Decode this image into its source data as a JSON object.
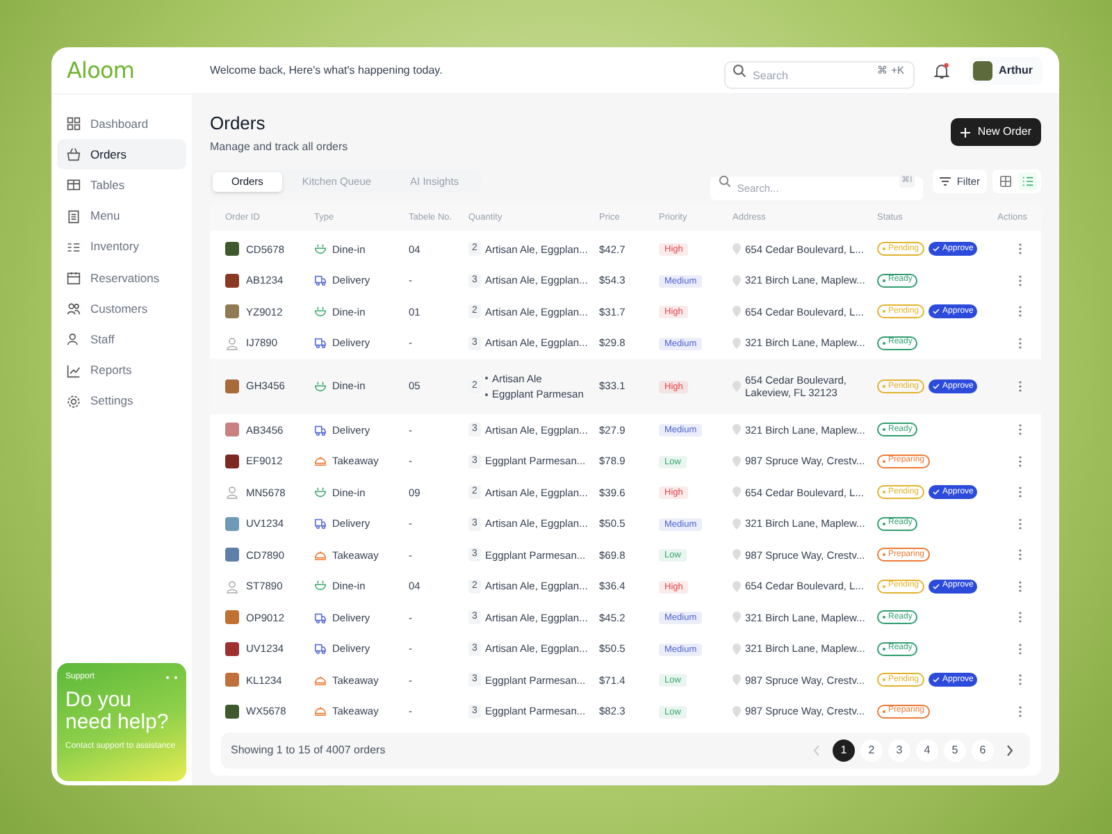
{
  "logo": "Aloom",
  "sidebar": {
    "items": [
      {
        "label": "Dashboard",
        "selected": false
      },
      {
        "label": "Orders",
        "selected": true
      },
      {
        "label": "Tables",
        "selected": false
      },
      {
        "label": "Menu",
        "selected": false
      },
      {
        "label": "Inventory",
        "selected": false
      },
      {
        "label": "Reservations",
        "selected": false
      },
      {
        "label": "Customers",
        "selected": false
      },
      {
        "label": "Staff",
        "selected": false
      },
      {
        "label": "Reports",
        "selected": false
      },
      {
        "label": "Settings",
        "selected": false
      }
    ],
    "support": {
      "label": "Support",
      "title": "Do you need help?",
      "text": "Contact support to assistance"
    }
  },
  "topbar": {
    "welcome": "Welcome back, Here's what's happening today.",
    "search": {
      "placeholder": "Search",
      "shortcut": "⌘ +K"
    },
    "notifications": {
      "unread": true
    },
    "user": {
      "name": "Arthur"
    }
  },
  "page": {
    "title": "Orders",
    "subtitle": "Manage and track all orders",
    "new_button": "New Order"
  },
  "tabs": [
    {
      "label": "Orders",
      "selected": true
    },
    {
      "label": "Kitchen Queue",
      "selected": false
    },
    {
      "label": "AI Insights",
      "selected": false
    }
  ],
  "table_search": {
    "placeholder": "Search...",
    "shortcut": "⌘I"
  },
  "filter_button": "Filter",
  "view_toggle": [
    {
      "kind": "grid",
      "selected": false
    },
    {
      "kind": "list",
      "selected": true
    }
  ],
  "table": {
    "columns": [
      "Order ID",
      "Type",
      "Tabele No.",
      "Quantity",
      "Price",
      "Priority",
      "Address",
      "Status",
      "Actions"
    ],
    "rows": [
      {
        "id": "CD5678",
        "avatar": {
          "kind": "photo"
        },
        "type": {
          "kind": "dine-in",
          "label": "Dine-in"
        },
        "table": "04",
        "qty": "2",
        "items": "Artisan Ale, Eggplan...",
        "price": "$42.7",
        "priority": {
          "label": "High",
          "color": "#e5484d"
        },
        "address": "654 Cedar Boulevard, L...",
        "status": {
          "label": "Pending",
          "color": "#e3b22c"
        },
        "approve": "Approve",
        "expanded": false
      },
      {
        "id": "AB1234",
        "avatar": {
          "kind": "photo"
        },
        "type": {
          "kind": "delivery",
          "label": "Delivery"
        },
        "table": "-",
        "qty": "3",
        "items": "Artisan Ale, Eggplan...",
        "price": "$54.3",
        "priority": {
          "label": "Medium",
          "color": "#4c63d2"
        },
        "address": "321 Birch Lane, Maplew...",
        "status": {
          "label": "Ready",
          "color": "#2f9e6e"
        },
        "expanded": false
      },
      {
        "id": "YZ9012",
        "avatar": {
          "kind": "photo"
        },
        "type": {
          "kind": "dine-in",
          "label": "Dine-in"
        },
        "table": "01",
        "qty": "2",
        "items": "Artisan Ale, Eggplan...",
        "price": "$31.7",
        "priority": {
          "label": "High",
          "color": "#e5484d"
        },
        "address": "654 Cedar Boulevard, L...",
        "status": {
          "label": "Pending",
          "color": "#e3b22c"
        },
        "approve": "Approve",
        "expanded": false
      },
      {
        "id": "IJ7890",
        "avatar": {
          "kind": "placeholder"
        },
        "type": {
          "kind": "delivery",
          "label": "Delivery"
        },
        "table": "-",
        "qty": "3",
        "items": "Artisan Ale, Eggplan...",
        "price": "$29.8",
        "priority": {
          "label": "Medium",
          "color": "#4c63d2"
        },
        "address": "321 Birch Lane, Maplew...",
        "status": {
          "label": "Ready",
          "color": "#2f9e6e"
        },
        "expanded": false
      },
      {
        "id": "GH3456",
        "avatar": {
          "kind": "photo"
        },
        "type": {
          "kind": "dine-in",
          "label": "Dine-in"
        },
        "table": "05",
        "qty": "2",
        "items": [
          "Artisan Ale",
          "Eggplant Parmesan"
        ],
        "price": "$33.1",
        "priority": {
          "label": "High",
          "color": "#e5484d"
        },
        "address": "654 Cedar Boulevard, Lakeview, FL 32123",
        "status": {
          "label": "Pending",
          "color": "#e3b22c"
        },
        "approve": "Approve",
        "expanded": true
      },
      {
        "id": "AB3456",
        "avatar": {
          "kind": "photo"
        },
        "type": {
          "kind": "delivery",
          "label": "Delivery"
        },
        "table": "-",
        "qty": "3",
        "items": "Artisan Ale, Eggplan...",
        "price": "$27.9",
        "priority": {
          "label": "Medium",
          "color": "#4c63d2"
        },
        "address": "321 Birch Lane, Maplew...",
        "status": {
          "label": "Ready",
          "color": "#2f9e6e"
        },
        "expanded": false
      },
      {
        "id": "EF9012",
        "avatar": {
          "kind": "photo"
        },
        "type": {
          "kind": "takeaway",
          "label": "Takeaway"
        },
        "table": "-",
        "qty": "3",
        "items": "Eggplant Parmesan...",
        "price": "$78.9",
        "priority": {
          "label": "Low",
          "color": "#3aa76d"
        },
        "address": "987 Spruce Way, Crestv...",
        "status": {
          "label": "Preparing",
          "color": "#ef7a34"
        },
        "expanded": false
      },
      {
        "id": "MN5678",
        "avatar": {
          "kind": "placeholder"
        },
        "type": {
          "kind": "dine-in",
          "label": "Dine-in"
        },
        "table": "09",
        "qty": "2",
        "items": "Artisan Ale, Eggplan...",
        "price": "$39.6",
        "priority": {
          "label": "High",
          "color": "#e5484d"
        },
        "address": "654 Cedar Boulevard, L...",
        "status": {
          "label": "Pending",
          "color": "#e3b22c"
        },
        "approve": "Approve",
        "expanded": false
      },
      {
        "id": "UV1234",
        "avatar": {
          "kind": "photo"
        },
        "type": {
          "kind": "delivery",
          "label": "Delivery"
        },
        "table": "-",
        "qty": "3",
        "items": "Artisan Ale, Eggplan...",
        "price": "$50.5",
        "priority": {
          "label": "Medium",
          "color": "#4c63d2"
        },
        "address": "321 Birch Lane, Maplew...",
        "status": {
          "label": "Ready",
          "color": "#2f9e6e"
        },
        "expanded": false
      },
      {
        "id": "CD7890",
        "avatar": {
          "kind": "photo"
        },
        "type": {
          "kind": "takeaway",
          "label": "Takeaway"
        },
        "table": "-",
        "qty": "3",
        "items": "Eggplant Parmesan...",
        "price": "$69.8",
        "priority": {
          "label": "Low",
          "color": "#3aa76d"
        },
        "address": "987 Spruce Way, Crestv...",
        "status": {
          "label": "Preparing",
          "color": "#ef7a34"
        },
        "expanded": false
      },
      {
        "id": "ST7890",
        "avatar": {
          "kind": "placeholder"
        },
        "type": {
          "kind": "dine-in",
          "label": "Dine-in"
        },
        "table": "04",
        "qty": "2",
        "items": "Artisan Ale, Eggplan...",
        "price": "$36.4",
        "priority": {
          "label": "High",
          "color": "#e5484d"
        },
        "address": "654 Cedar Boulevard, L...",
        "status": {
          "label": "Pending",
          "color": "#e3b22c"
        },
        "approve": "Approve",
        "expanded": false
      },
      {
        "id": "OP9012",
        "avatar": {
          "kind": "photo"
        },
        "type": {
          "kind": "delivery",
          "label": "Delivery"
        },
        "table": "-",
        "qty": "3",
        "items": "Artisan Ale, Eggplan...",
        "price": "$45.2",
        "priority": {
          "label": "Medium",
          "color": "#4c63d2"
        },
        "address": "321 Birch Lane, Maplew...",
        "status": {
          "label": "Ready",
          "color": "#2f9e6e"
        },
        "expanded": false
      },
      {
        "id": "UV1234",
        "avatar": {
          "kind": "photo"
        },
        "type": {
          "kind": "delivery",
          "label": "Delivery"
        },
        "table": "-",
        "qty": "3",
        "items": "Artisan Ale, Eggplan...",
        "price": "$50.5",
        "priority": {
          "label": "Medium",
          "color": "#4c63d2"
        },
        "address": "321 Birch Lane, Maplew...",
        "status": {
          "label": "Ready",
          "color": "#2f9e6e"
        },
        "expanded": false
      },
      {
        "id": "KL1234",
        "avatar": {
          "kind": "photo"
        },
        "type": {
          "kind": "takeaway",
          "label": "Takeaway"
        },
        "table": "-",
        "qty": "3",
        "items": "Eggplant Parmesan...",
        "price": "$71.4",
        "priority": {
          "label": "Low",
          "color": "#3aa76d"
        },
        "address": "987 Spruce Way, Crestv...",
        "status": {
          "label": "Pending",
          "color": "#e3b22c"
        },
        "approve": "Approve",
        "expanded": false
      },
      {
        "id": "WX5678",
        "avatar": {
          "kind": "photo"
        },
        "type": {
          "kind": "takeaway",
          "label": "Takeaway"
        },
        "table": "-",
        "qty": "3",
        "items": "Eggplant Parmesan...",
        "price": "$82.3",
        "priority": {
          "label": "Low",
          "color": "#3aa76d"
        },
        "address": "987 Spruce Way, Crestv...",
        "status": {
          "label": "Preparing",
          "color": "#ef7a34"
        },
        "expanded": false
      }
    ]
  },
  "pagination": {
    "summary": "Showing 1 to 15 of 4007 orders",
    "prev": {
      "disabled": true
    },
    "next": {
      "disabled": false
    },
    "pages": [
      {
        "label": "1",
        "selected": true
      },
      {
        "label": "2",
        "selected": false
      },
      {
        "label": "3",
        "selected": false
      },
      {
        "label": "4",
        "selected": false
      },
      {
        "label": "5",
        "selected": false
      },
      {
        "label": "6",
        "selected": false
      }
    ]
  }
}
